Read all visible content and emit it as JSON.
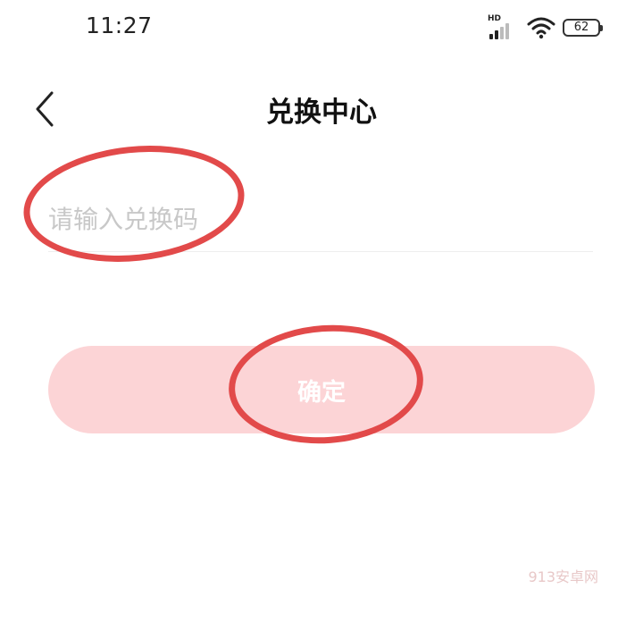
{
  "status_bar": {
    "time": "11:27",
    "network_label": "HD",
    "battery": "62",
    "icons": [
      "signal-icon",
      "wifi-icon",
      "battery-icon"
    ]
  },
  "header": {
    "title": "兑换中心",
    "back_icon": "chevron-left-icon"
  },
  "form": {
    "code_placeholder": "请输入兑换码",
    "code_value": "",
    "confirm_label": "确定"
  },
  "watermark": "913安卓网",
  "colors": {
    "button_bg": "#fcd4d6",
    "button_text": "#ffffff",
    "highlight_ring": "#e24a4a",
    "placeholder": "#c8c8c8"
  }
}
